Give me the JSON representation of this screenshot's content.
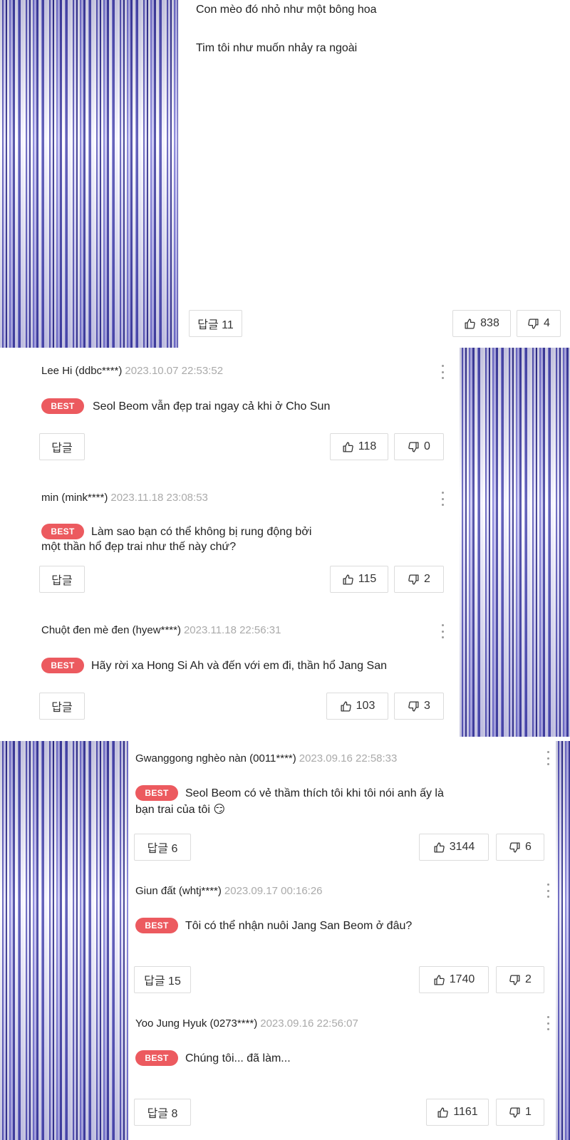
{
  "top_post": {
    "lines": [
      "Con mèo đó nhỏ như một bông hoa",
      "Tim tôi như muốn nhảy ra ngoài"
    ],
    "reply_label": "답글 11",
    "likes": "838",
    "dislikes": "4"
  },
  "comments": [
    {
      "user": "Lee Hi (ddbc****)",
      "date": "2023.10.07 22:53:52",
      "badge": "BEST",
      "text_lines": [
        "Seol Beom vẫn đẹp trai ngay cả khi ở Cho Sun"
      ],
      "reply_label": "답글",
      "likes": "118",
      "dislikes": "0"
    },
    {
      "user": "min (mink****)",
      "date": "2023.11.18 23:08:53",
      "badge": "BEST",
      "text_lines": [
        "Làm sao bạn có thể không bị rung động bởi",
        "một thần hổ đẹp trai như thế này chứ?"
      ],
      "reply_label": "답글",
      "likes": "115",
      "dislikes": "2"
    },
    {
      "user": "Chuột đen mè đen (hyew****)",
      "date": "2023.11.18 22:56:31",
      "badge": "BEST",
      "text_lines": [
        "Hãy rời xa Hong Si Ah và đến với em đi, thần hổ Jang San"
      ],
      "reply_label": "답글",
      "likes": "103",
      "dislikes": "3"
    },
    {
      "user": "Gwanggong nghèo nàn (0011****)",
      "date": "2023.09.16 22:58:33",
      "badge": "BEST",
      "text_lines": [
        "Seol Beom có vẻ thầm thích tôi khi tôi nói anh ấy là",
        "bạn trai của tôi 😏"
      ],
      "reply_label": "답글 6",
      "likes": "3144",
      "dislikes": "6"
    },
    {
      "user": "Giun đất (whtj****)",
      "date": "2023.09.17 00:16:26",
      "badge": "BEST",
      "text_lines": [
        "Tôi có thể nhận nuôi Jang San Beom ở đâu?"
      ],
      "reply_label": "답글 15",
      "likes": "1740",
      "dislikes": "2"
    },
    {
      "user": "Yoo Jung Hyuk (0273****)",
      "date": "2023.09.16 22:56:07",
      "badge": "BEST",
      "text_lines": [
        "Chúng tôi... đã làm..."
      ],
      "reply_label": "답글 8",
      "likes": "1161",
      "dislikes": "1"
    }
  ],
  "colors": {
    "best_badge": "#ec5a5f",
    "speedline_dark": "#2c2a86",
    "speedline_mid": "#5a57b8",
    "date_gray": "#aaaaaa"
  }
}
